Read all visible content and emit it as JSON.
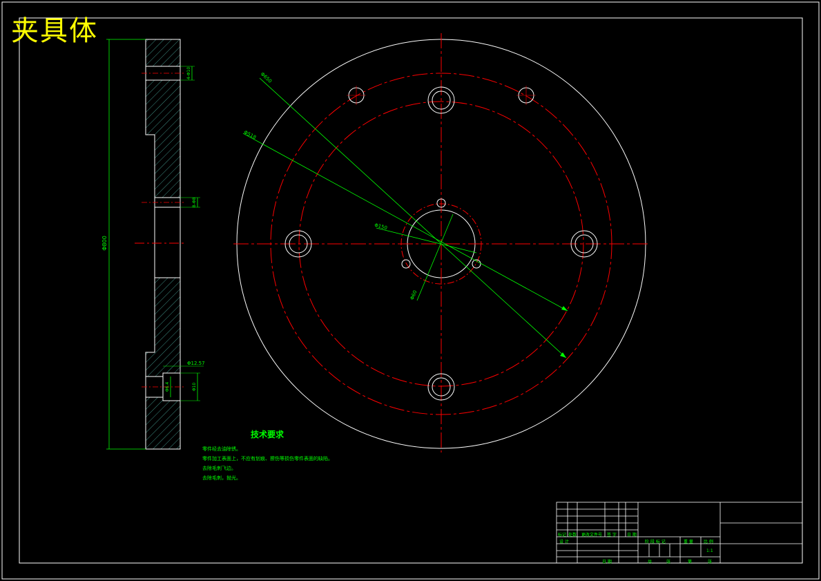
{
  "title": "夹具体",
  "dimensions": {
    "overall_height": "Φ800",
    "bolt_circle_1": "Φ650",
    "bolt_circle_2": "Φ518",
    "inner_circle_1": "Φ150",
    "inner_circle_2": "Φ60",
    "hole_small_top": "4-Φ10",
    "hole_small_mid": "8-Φ8",
    "counterbore_outer": "Φ12.57",
    "counterbore_depth": "Φ10",
    "counterbore_inner": "Φ6.4"
  },
  "technical_requirements": {
    "title": "技术要求",
    "notes": [
      "零件经去油除锈。",
      "零件加工表面上，不应有划痕、擦伤等损伤零件表面的缺陷。",
      "去除毛刺飞边。",
      "去除毛刺，抛光。"
    ]
  },
  "title_block": {
    "row_labels": [
      "标记",
      "处数",
      "更改文件号",
      "签 字",
      "日 期"
    ],
    "design": "设 计",
    "stage_header": [
      "阶 段 标 记",
      "重 量",
      "比 例"
    ],
    "scale": "1:1",
    "sheet": [
      "共",
      "张",
      "第",
      "张"
    ],
    "approve": "日 期"
  }
}
